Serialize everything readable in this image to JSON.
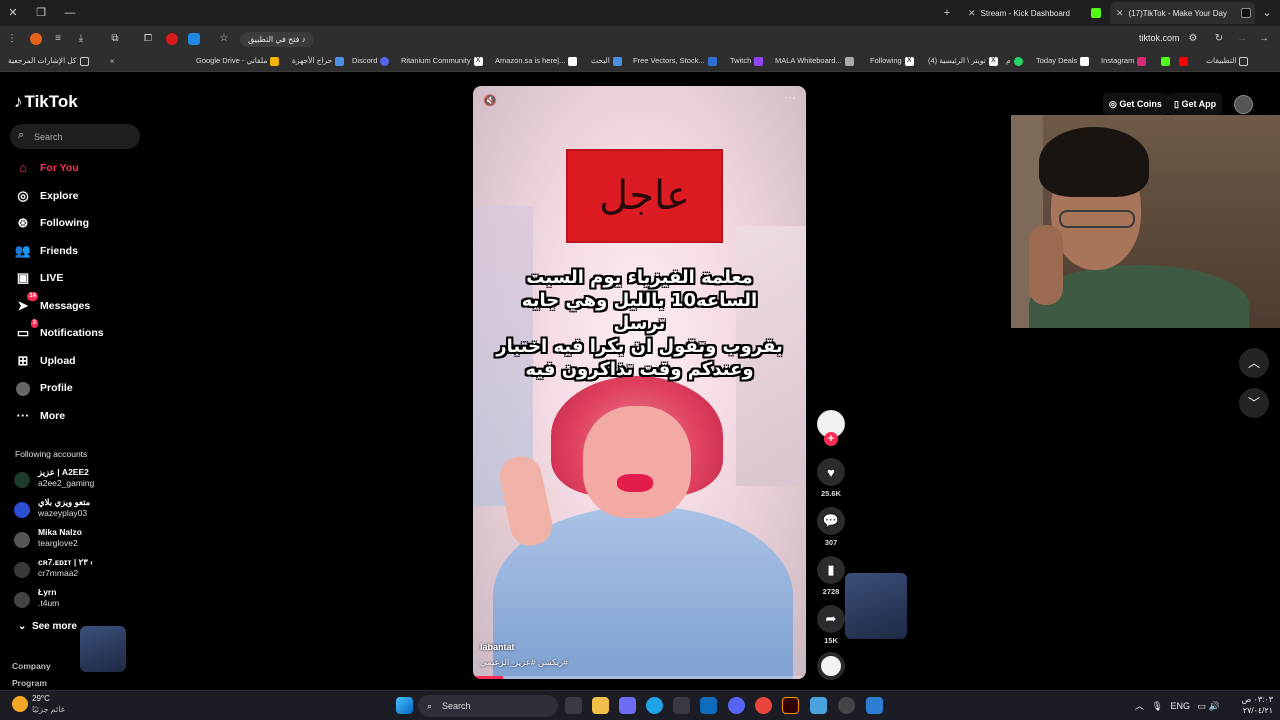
{
  "browser": {
    "tabs": [
      {
        "title": "Stream - Kick Dashboard",
        "color": "#53fc18"
      },
      {
        "title": "(17)TikTok - Make Your Day",
        "color": "#ffffff"
      }
    ],
    "install_app_label": "فتح في التطبيق",
    "url": "tiktok.com",
    "bookmarks": [
      "كل الإشارات المرجعية",
      "Google Drive - ملفاتي",
      "حراج الأجهزة",
      "Discord",
      "Ritanium Community",
      "Amazon.sa is here|...",
      "البحث",
      "Free Vectors, Stock...",
      "Twitch",
      "MALA Whiteboard...",
      "Following",
      "(4) تويتر \\ الرئيسية",
      "م",
      "Today Deals",
      "Instagram",
      "التطبيقات"
    ]
  },
  "tiktok": {
    "logo": "TikTok",
    "search_placeholder": "Search",
    "nav": [
      {
        "label": "For You",
        "icon": "home-icon",
        "active": true
      },
      {
        "label": "Explore",
        "icon": "compass-icon"
      },
      {
        "label": "Following",
        "icon": "following-icon"
      },
      {
        "label": "Friends",
        "icon": "friends-icon"
      },
      {
        "label": "LIVE",
        "icon": "live-icon"
      },
      {
        "label": "Messages",
        "icon": "messages-icon",
        "badge": "14"
      },
      {
        "label": "Notifications",
        "icon": "notifications-icon",
        "badge": "3"
      },
      {
        "label": "Upload",
        "icon": "upload-icon"
      },
      {
        "label": "Profile",
        "icon": "profile-icon"
      },
      {
        "label": "More",
        "icon": "more-icon"
      }
    ],
    "following_title": "Following accounts",
    "accounts": [
      {
        "name": "عزيز | A2EE2",
        "handle": "a2ee2_gaming",
        "color": "#1f3a2a"
      },
      {
        "name": "متعو ويزي بلاي",
        "handle": "wazeyplay03",
        "color": "#2c4fd1"
      },
      {
        "name": "Mika Nalzo",
        "handle": "tearglove2",
        "color": "#555555"
      },
      {
        "name": "ᴄʀ7.ᴇᴅɪᴛ | ۲۳ ‹",
        "handle": "cr7mmaa2",
        "color": "#3a3a3a"
      },
      {
        "name": "Łyrn",
        "handle": ".t4um",
        "color": "#444444"
      }
    ],
    "see_more": "See more",
    "footer": [
      "Company",
      "Program"
    ],
    "header": {
      "get_coins": "Get Coins",
      "get_app": "Get App"
    },
    "video": {
      "breaking_text": "عاجل",
      "caption_lines": [
        "معلمة الفيزياء يوم السبت",
        "الساعه10 بالليل وهي جايه ترسل",
        "بقروب وتقول ان بكرا فيه اختبار",
        "وعندكم وقت تذاكرون فيه"
      ],
      "author": "labantat",
      "tags": "#ريكشن #عزيز_الزعيمي",
      "progress": 0.09
    },
    "actions": {
      "likes": "25.6K",
      "comments": "307",
      "saves": "2728",
      "shares": "15K"
    }
  },
  "taskbar": {
    "weather_temp": "29°C",
    "weather_desc": "غائم جزئيًا",
    "search_label": "Search",
    "language": "ENG",
    "time": "٠٣:٠٣ ص",
    "date": "٢٧/٠٤/٢١"
  }
}
